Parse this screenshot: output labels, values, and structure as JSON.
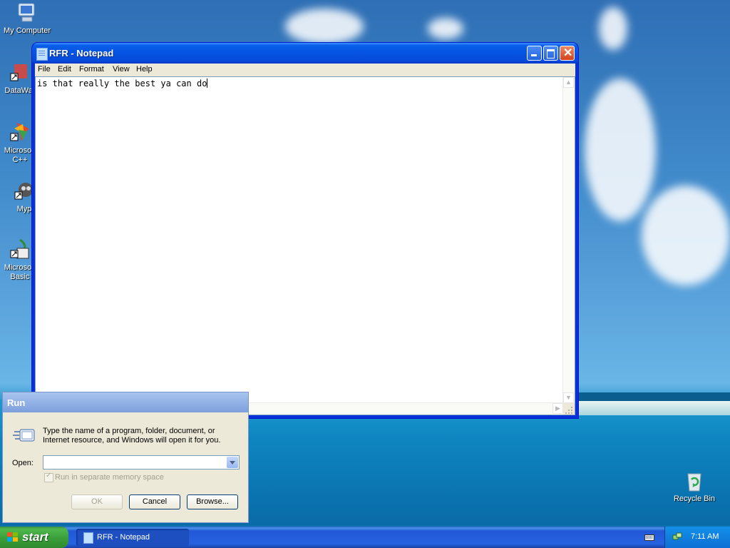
{
  "desktop": {
    "icons": [
      {
        "label": "My Computer"
      },
      {
        "label": "DataWar"
      },
      {
        "label": "Microsoft\nC++"
      },
      {
        "label": "Myp"
      },
      {
        "label": "Microsoft\nBasic"
      },
      {
        "label": "Recycle Bin"
      }
    ]
  },
  "notepad": {
    "title": "RFR - Notepad",
    "menu": [
      "File",
      "Edit",
      "Format",
      "View",
      "Help"
    ],
    "content": "is that really the best ya can do"
  },
  "run_dialog": {
    "title": "Run",
    "description": "Type the name of a program, folder, document, or Internet resource, and Windows will open it for you.",
    "open_label": "Open:",
    "open_value": "",
    "checkbox_label": "Run in separate memory space",
    "ok_label": "OK",
    "cancel_label": "Cancel",
    "browse_label": "Browse..."
  },
  "taskbar": {
    "start_label": "start",
    "tasks": [
      {
        "label": "RFR - Notepad"
      }
    ],
    "clock": "7:11 AM"
  }
}
